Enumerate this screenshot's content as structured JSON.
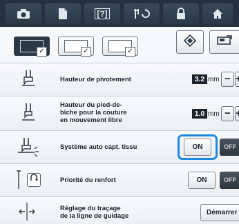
{
  "toolbar": {
    "buttons": [
      {
        "icon": "camera-icon"
      },
      {
        "icon": "page-icon"
      },
      {
        "icon": "help-icon",
        "text": "[?]"
      },
      {
        "icon": "needle-thread-icon"
      },
      {
        "icon": "lock-icon"
      },
      {
        "icon": "home-icon"
      }
    ]
  },
  "tabs": [
    {
      "icon": "sewing-settings-tab-icon",
      "active": true
    },
    {
      "icon": "embroidery-settings-tab-icon",
      "active": false
    },
    {
      "icon": "general-settings-tab-icon",
      "active": false
    }
  ],
  "side_buttons": [
    {
      "icon": "reset-diamond-icon"
    },
    {
      "icon": "machine-info-icon"
    }
  ],
  "settings": [
    {
      "label_lines": [
        "Hauteur de pivotement"
      ],
      "value": "3.2",
      "unit": "mm",
      "minus": "−",
      "plus": "+"
    },
    {
      "label_lines": [
        "Hauteur du pied-de-",
        "biche pour la couture",
        "en mouvement libre"
      ],
      "value": "1.0",
      "unit": "mm",
      "minus": "−",
      "plus": "+"
    },
    {
      "label_lines": [
        "Système auto capt. tissu"
      ],
      "on_label": "ON",
      "off_label": "OFF",
      "selected": "ON",
      "highlighted": true
    },
    {
      "label_lines": [
        "Priorité du renfort"
      ],
      "on_label": "ON",
      "off_label": "OFF",
      "selected": "OFF"
    },
    {
      "label_lines": [
        "Réglage du traçage",
        "de la ligne de guidage"
      ],
      "button_label": "Démarrer"
    }
  ],
  "colors": {
    "toolbar_bg": "#24313f",
    "highlight": "#1e88e0",
    "value_box": "#1b232c"
  }
}
